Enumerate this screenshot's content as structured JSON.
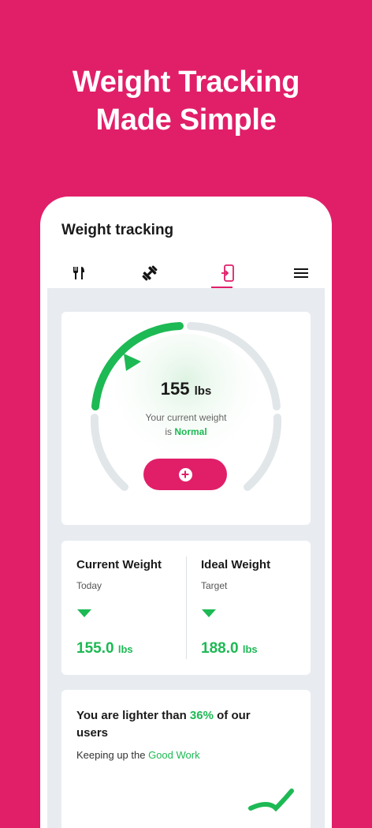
{
  "hero": {
    "line1": "Weight Tracking",
    "line2": "Made Simple"
  },
  "app": {
    "title": "Weight tracking"
  },
  "tabs": [
    {
      "name": "food",
      "icon": "fork-knife-icon",
      "active": false
    },
    {
      "name": "exercise",
      "icon": "dumbbell-icon",
      "active": false
    },
    {
      "name": "weight",
      "icon": "phone-login-icon",
      "active": true
    },
    {
      "name": "menu",
      "icon": "hamburger-menu-icon",
      "active": false
    }
  ],
  "gauge": {
    "value": "155",
    "unit": "lbs",
    "caption_line1": "Your current weight",
    "caption_prefix": "is",
    "status": "Normal",
    "add_icon": "plus-circle-icon"
  },
  "stats": {
    "current": {
      "title": "Current Weight",
      "sub": "Today",
      "value": "155.0",
      "unit": "lbs"
    },
    "ideal": {
      "title": "Ideal Weight",
      "sub": "Target",
      "value": "188.0",
      "unit": "lbs"
    }
  },
  "comparison": {
    "title_prefix": "You are lighter than",
    "percent": "36%",
    "title_suffix": "of our users",
    "sub_prefix": "Keeping up the",
    "sub_highlight": "Good Work"
  },
  "colors": {
    "brand": "#E11F69",
    "accent": "#1DB954",
    "panel_bg": "#E8ECF0"
  }
}
